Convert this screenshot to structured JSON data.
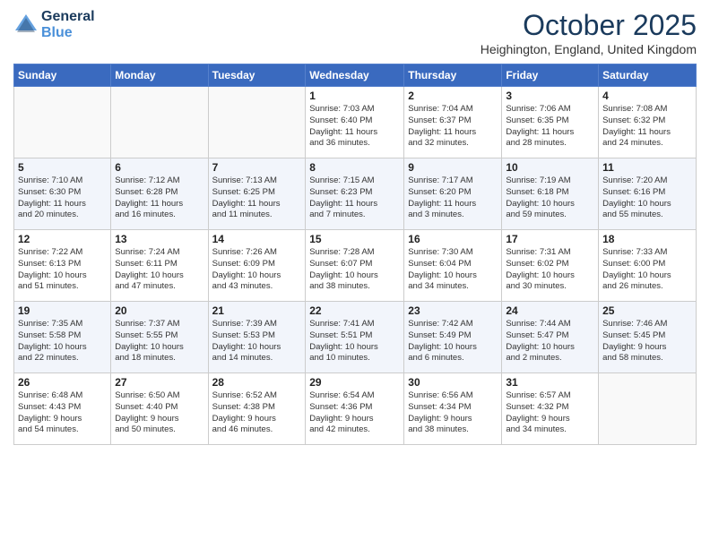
{
  "logo": {
    "line1": "General",
    "line2": "Blue"
  },
  "title": "October 2025",
  "location": "Heighington, England, United Kingdom",
  "days_of_week": [
    "Sunday",
    "Monday",
    "Tuesday",
    "Wednesday",
    "Thursday",
    "Friday",
    "Saturday"
  ],
  "weeks": [
    [
      {
        "num": "",
        "info": ""
      },
      {
        "num": "",
        "info": ""
      },
      {
        "num": "",
        "info": ""
      },
      {
        "num": "1",
        "info": "Sunrise: 7:03 AM\nSunset: 6:40 PM\nDaylight: 11 hours\nand 36 minutes."
      },
      {
        "num": "2",
        "info": "Sunrise: 7:04 AM\nSunset: 6:37 PM\nDaylight: 11 hours\nand 32 minutes."
      },
      {
        "num": "3",
        "info": "Sunrise: 7:06 AM\nSunset: 6:35 PM\nDaylight: 11 hours\nand 28 minutes."
      },
      {
        "num": "4",
        "info": "Sunrise: 7:08 AM\nSunset: 6:32 PM\nDaylight: 11 hours\nand 24 minutes."
      }
    ],
    [
      {
        "num": "5",
        "info": "Sunrise: 7:10 AM\nSunset: 6:30 PM\nDaylight: 11 hours\nand 20 minutes."
      },
      {
        "num": "6",
        "info": "Sunrise: 7:12 AM\nSunset: 6:28 PM\nDaylight: 11 hours\nand 16 minutes."
      },
      {
        "num": "7",
        "info": "Sunrise: 7:13 AM\nSunset: 6:25 PM\nDaylight: 11 hours\nand 11 minutes."
      },
      {
        "num": "8",
        "info": "Sunrise: 7:15 AM\nSunset: 6:23 PM\nDaylight: 11 hours\nand 7 minutes."
      },
      {
        "num": "9",
        "info": "Sunrise: 7:17 AM\nSunset: 6:20 PM\nDaylight: 11 hours\nand 3 minutes."
      },
      {
        "num": "10",
        "info": "Sunrise: 7:19 AM\nSunset: 6:18 PM\nDaylight: 10 hours\nand 59 minutes."
      },
      {
        "num": "11",
        "info": "Sunrise: 7:20 AM\nSunset: 6:16 PM\nDaylight: 10 hours\nand 55 minutes."
      }
    ],
    [
      {
        "num": "12",
        "info": "Sunrise: 7:22 AM\nSunset: 6:13 PM\nDaylight: 10 hours\nand 51 minutes."
      },
      {
        "num": "13",
        "info": "Sunrise: 7:24 AM\nSunset: 6:11 PM\nDaylight: 10 hours\nand 47 minutes."
      },
      {
        "num": "14",
        "info": "Sunrise: 7:26 AM\nSunset: 6:09 PM\nDaylight: 10 hours\nand 43 minutes."
      },
      {
        "num": "15",
        "info": "Sunrise: 7:28 AM\nSunset: 6:07 PM\nDaylight: 10 hours\nand 38 minutes."
      },
      {
        "num": "16",
        "info": "Sunrise: 7:30 AM\nSunset: 6:04 PM\nDaylight: 10 hours\nand 34 minutes."
      },
      {
        "num": "17",
        "info": "Sunrise: 7:31 AM\nSunset: 6:02 PM\nDaylight: 10 hours\nand 30 minutes."
      },
      {
        "num": "18",
        "info": "Sunrise: 7:33 AM\nSunset: 6:00 PM\nDaylight: 10 hours\nand 26 minutes."
      }
    ],
    [
      {
        "num": "19",
        "info": "Sunrise: 7:35 AM\nSunset: 5:58 PM\nDaylight: 10 hours\nand 22 minutes."
      },
      {
        "num": "20",
        "info": "Sunrise: 7:37 AM\nSunset: 5:55 PM\nDaylight: 10 hours\nand 18 minutes."
      },
      {
        "num": "21",
        "info": "Sunrise: 7:39 AM\nSunset: 5:53 PM\nDaylight: 10 hours\nand 14 minutes."
      },
      {
        "num": "22",
        "info": "Sunrise: 7:41 AM\nSunset: 5:51 PM\nDaylight: 10 hours\nand 10 minutes."
      },
      {
        "num": "23",
        "info": "Sunrise: 7:42 AM\nSunset: 5:49 PM\nDaylight: 10 hours\nand 6 minutes."
      },
      {
        "num": "24",
        "info": "Sunrise: 7:44 AM\nSunset: 5:47 PM\nDaylight: 10 hours\nand 2 minutes."
      },
      {
        "num": "25",
        "info": "Sunrise: 7:46 AM\nSunset: 5:45 PM\nDaylight: 9 hours\nand 58 minutes."
      }
    ],
    [
      {
        "num": "26",
        "info": "Sunrise: 6:48 AM\nSunset: 4:43 PM\nDaylight: 9 hours\nand 54 minutes."
      },
      {
        "num": "27",
        "info": "Sunrise: 6:50 AM\nSunset: 4:40 PM\nDaylight: 9 hours\nand 50 minutes."
      },
      {
        "num": "28",
        "info": "Sunrise: 6:52 AM\nSunset: 4:38 PM\nDaylight: 9 hours\nand 46 minutes."
      },
      {
        "num": "29",
        "info": "Sunrise: 6:54 AM\nSunset: 4:36 PM\nDaylight: 9 hours\nand 42 minutes."
      },
      {
        "num": "30",
        "info": "Sunrise: 6:56 AM\nSunset: 4:34 PM\nDaylight: 9 hours\nand 38 minutes."
      },
      {
        "num": "31",
        "info": "Sunrise: 6:57 AM\nSunset: 4:32 PM\nDaylight: 9 hours\nand 34 minutes."
      },
      {
        "num": "",
        "info": ""
      }
    ]
  ]
}
